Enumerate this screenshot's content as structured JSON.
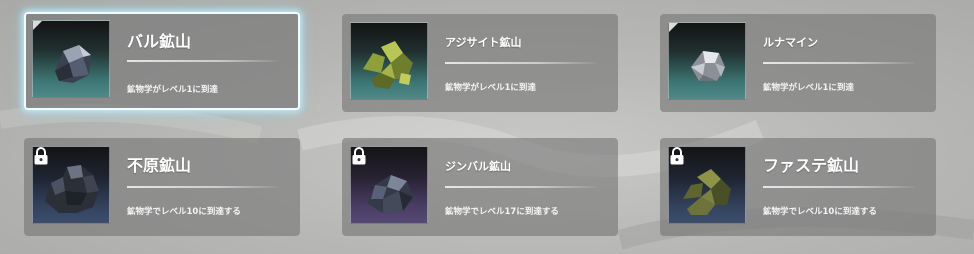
{
  "mines": [
    {
      "name": "バル鉱山",
      "requirement": "鉱物学がレベル1に到達",
      "locked": false,
      "selected": true,
      "name_size": "big",
      "ore_icon": "dark-blue-ore-icon",
      "bg": "teal"
    },
    {
      "name": "アジサイト鉱山",
      "requirement": "鉱物学がレベル1に到達",
      "locked": false,
      "selected": false,
      "name_size": "small",
      "ore_icon": "green-ore-icon",
      "bg": "teal"
    },
    {
      "name": "ルナマイン",
      "requirement": "鉱物学がレベル1に到達",
      "locked": false,
      "selected": false,
      "name_size": "small",
      "ore_icon": "silver-ore-icon",
      "bg": "teal"
    },
    {
      "name": "不原鉱山",
      "requirement": "鉱物学でレベル10に到達する",
      "locked": true,
      "selected": false,
      "name_size": "big",
      "ore_icon": "black-ore-icon",
      "bg": "blue"
    },
    {
      "name": "ジンバル鉱山",
      "requirement": "鉱物学でレベル17に到達する",
      "locked": true,
      "selected": false,
      "name_size": "small",
      "ore_icon": "slate-ore-icon",
      "bg": "purple"
    },
    {
      "name": "ファステ鉱山",
      "requirement": "鉱物学でレベル10に到達する",
      "locked": true,
      "selected": false,
      "name_size": "big",
      "ore_icon": "moss-ore-icon",
      "bg": "blue"
    }
  ],
  "colors": {
    "card_bg": "#767676",
    "selected_glow": "#bef0ff",
    "text": "#ffffff"
  }
}
